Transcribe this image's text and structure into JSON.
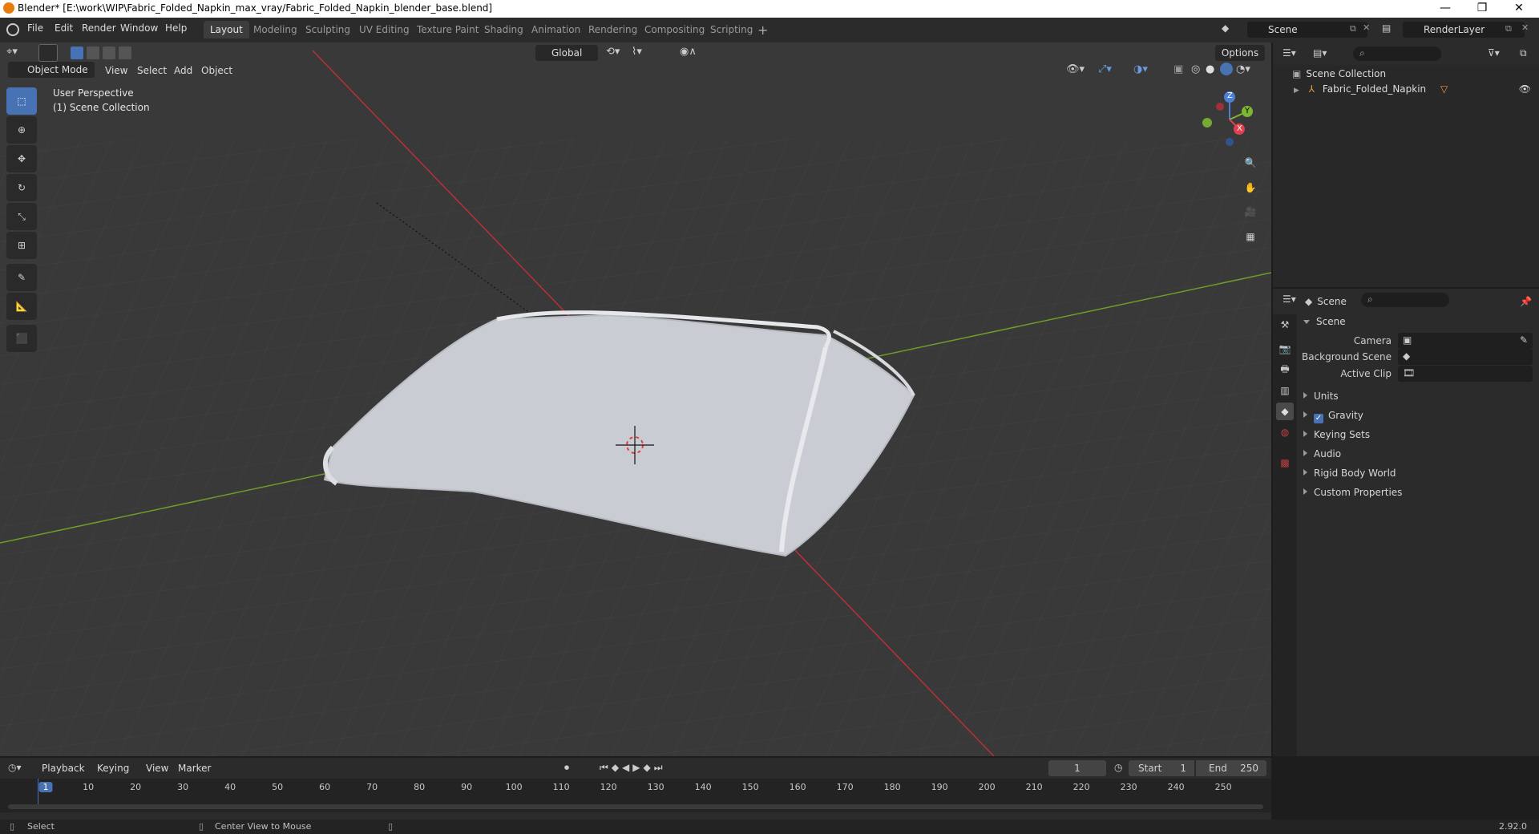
{
  "window": {
    "title": "Blender* [E:\\work\\WIP\\Fabric_Folded_Napkin_max_vray/Fabric_Folded_Napkin_blender_base.blend]",
    "controls": [
      "—",
      "❐",
      "✕"
    ]
  },
  "menubar": {
    "items": [
      "File",
      "Edit",
      "Render",
      "Window",
      "Help"
    ]
  },
  "workspaces": [
    "Layout",
    "Modeling",
    "Sculpting",
    "UV Editing",
    "Texture Paint",
    "Shading",
    "Animation",
    "Rendering",
    "Compositing",
    "Scripting"
  ],
  "active_workspace": "Layout",
  "scene_selector": {
    "value": "Scene"
  },
  "view_layer_selector": {
    "value": "RenderLayer"
  },
  "viewport": {
    "mode": "Object Mode",
    "menus": [
      "View",
      "Select",
      "Add",
      "Object"
    ],
    "transform_orientation": "Global",
    "options_label": "Options",
    "overlay_text": [
      "User Perspective",
      "(1) Scene Collection"
    ],
    "gizmo_axes": [
      "Z",
      "Y",
      "X"
    ]
  },
  "outliner": {
    "root": "Scene Collection",
    "items": [
      {
        "label": "Fabric_Folded_Napkin"
      }
    ]
  },
  "properties": {
    "context_label": "Scene",
    "panel_title": "Scene",
    "fields": [
      {
        "label": "Camera",
        "value": ""
      },
      {
        "label": "Background Scene",
        "value": ""
      },
      {
        "label": "Active Clip",
        "value": ""
      }
    ],
    "subpanels": [
      "Units",
      "Gravity",
      "Keying Sets",
      "Audio",
      "Rigid Body World",
      "Custom Properties"
    ],
    "gravity_checked": true
  },
  "timeline": {
    "menus": [
      "Playback",
      "Keying",
      "View",
      "Marker"
    ],
    "current_frame": "1",
    "start_label": "Start",
    "start": "1",
    "end_label": "End",
    "end": "250",
    "ruler_ticks": [
      "1",
      "10",
      "20",
      "30",
      "40",
      "50",
      "60",
      "70",
      "80",
      "90",
      "100",
      "110",
      "120",
      "130",
      "140",
      "150",
      "160",
      "170",
      "180",
      "190",
      "200",
      "210",
      "220",
      "230",
      "240",
      "250"
    ]
  },
  "statusbar": {
    "left": "Select",
    "middle": "Center View to Mouse",
    "version": "2.92.0"
  },
  "colors": {
    "accent": "#4772b3",
    "x_axis": "#c8303a",
    "y_axis": "#6f9c2a",
    "header_bg": "#2b2b2b",
    "viewport_bg": "#3a3a3a"
  }
}
